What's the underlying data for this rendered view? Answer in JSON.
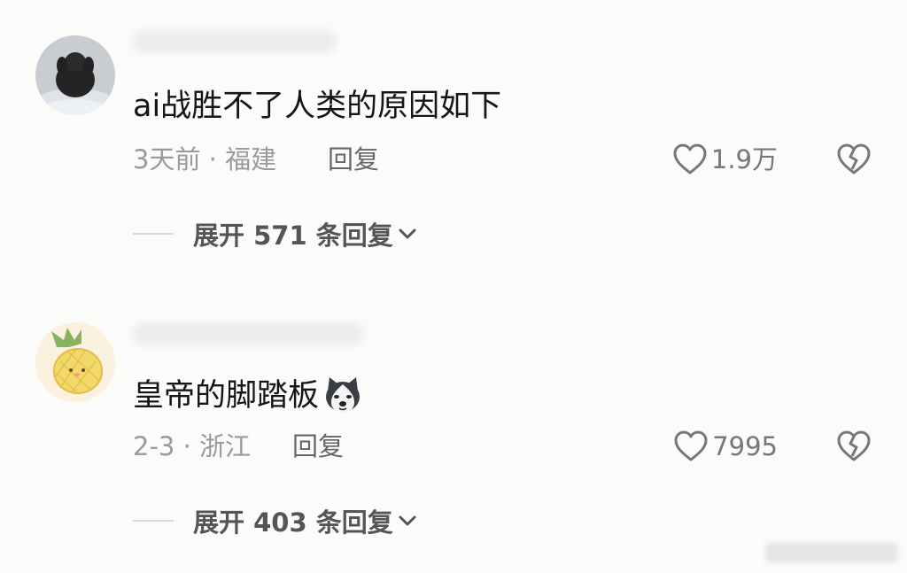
{
  "comments": [
    {
      "avatar_icon": "gorilla-avatar",
      "text": "ai战胜不了人类的原因如下",
      "time_location": "3天前 · 福建",
      "reply_label": "回复",
      "like_count": "1.9万",
      "expand_label": "展开 571 条回复"
    },
    {
      "avatar_icon": "pineapple-avatar",
      "text": "皇帝的脚踏板",
      "emoji_icon": "husky-emoji",
      "time_location": "2-3 · 浙江",
      "reply_label": "回复",
      "like_count": "7995",
      "expand_label": "展开 403 条回复"
    }
  ],
  "colors": {
    "background": "#fbfbf9",
    "text_primary": "#151515",
    "text_secondary": "#9a9a9a",
    "pineapple_body": "#f2d86a",
    "pineapple_leaf": "#86b35c"
  }
}
